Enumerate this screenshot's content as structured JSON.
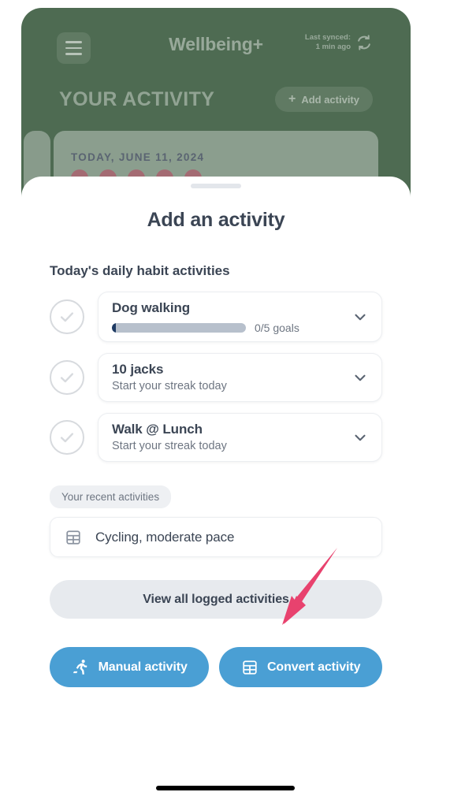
{
  "background_app": {
    "menu_icon": "hamburger-icon",
    "brand": "Wellbeing+",
    "sync_line1": "Last synced:",
    "sync_line2": "1 min ago",
    "sync_icon": "refresh-sync-icon",
    "section_title": "YOUR ACTIVITY",
    "add_activity_label": "Add activity",
    "add_icon": "plus-icon",
    "day_label": "TODAY, JUNE 11, 2024",
    "background_color": "#4e6b52"
  },
  "sheet": {
    "handle": "drag-handle",
    "title": "Add an activity",
    "section_label": "Today's daily habit activities",
    "habits": [
      {
        "name": "Dog walking",
        "check_icon": "check-circle-icon",
        "chevron_icon": "chevron-down-icon",
        "has_progress": true,
        "progress_text": "0/5 goals",
        "progress_value": 0,
        "progress_max": 5,
        "subtitle": ""
      },
      {
        "name": "10 jacks",
        "check_icon": "check-circle-icon",
        "chevron_icon": "chevron-down-icon",
        "has_progress": false,
        "progress_text": "",
        "subtitle": "Start your streak today"
      },
      {
        "name": "Walk @ Lunch",
        "check_icon": "check-circle-icon",
        "chevron_icon": "chevron-down-icon",
        "has_progress": false,
        "progress_text": "",
        "subtitle": "Start your streak today"
      }
    ],
    "recent_pill_label": "Your recent activities",
    "recent_items": [
      {
        "label": "Cycling, moderate pace",
        "icon": "grid-table-icon"
      }
    ],
    "view_all_label": "View all logged activities",
    "actions": [
      {
        "label": "Manual activity",
        "icon": "running-person-icon",
        "color": "#4a9fd4"
      },
      {
        "label": "Convert activity",
        "icon": "grid-table-icon",
        "color": "#4a9fd4"
      }
    ]
  },
  "annotation": {
    "arrow_color": "#e8426e",
    "arrow_name": "annotation-arrow"
  },
  "system": {
    "home_indicator": "home-indicator"
  }
}
